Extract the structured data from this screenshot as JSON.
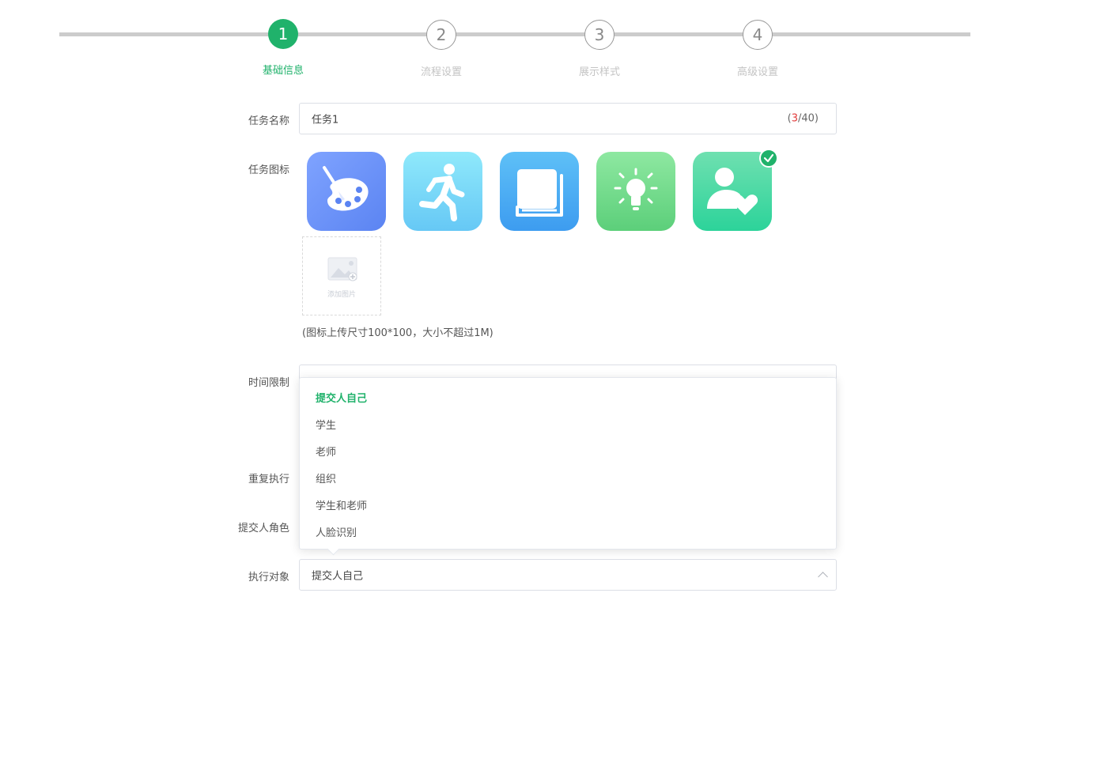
{
  "steps": [
    {
      "num": "1",
      "label": "基础信息",
      "state": "active"
    },
    {
      "num": "2",
      "label": "流程设置",
      "state": "idle"
    },
    {
      "num": "3",
      "label": "展示样式",
      "state": "idle"
    },
    {
      "num": "4",
      "label": "高级设置",
      "state": "idle"
    }
  ],
  "form": {
    "task_name_label": "任务名称",
    "task_name_value": "任务1",
    "task_name_counter_current": "3",
    "task_name_counter_max": "/40)",
    "task_name_counter_open": "(",
    "task_icon_label": "任务图标",
    "icons": [
      "palette-icon",
      "running-person-icon",
      "book-icon",
      "lightbulb-icon",
      "person-heart-icon"
    ],
    "selected_icon": "person-heart-icon",
    "add_image_label": "添加图片",
    "icon_hint": "(图标上传尺寸100*100，大小不超过1M)",
    "time_limit_label": "时间限制",
    "time_limit_value": "",
    "repeat_label": "重复执行",
    "submitter_role_label": "提交人角色",
    "target_label": "执行对象",
    "target_value": "提交人自己"
  },
  "dropdown": {
    "options": [
      "提交人自己",
      "学生",
      "老师",
      "组织",
      "学生和老师",
      "人脸识别"
    ],
    "selected": "提交人自己"
  },
  "colors": {
    "accent": "#20b26b",
    "counter_current": "#e23b3b"
  }
}
